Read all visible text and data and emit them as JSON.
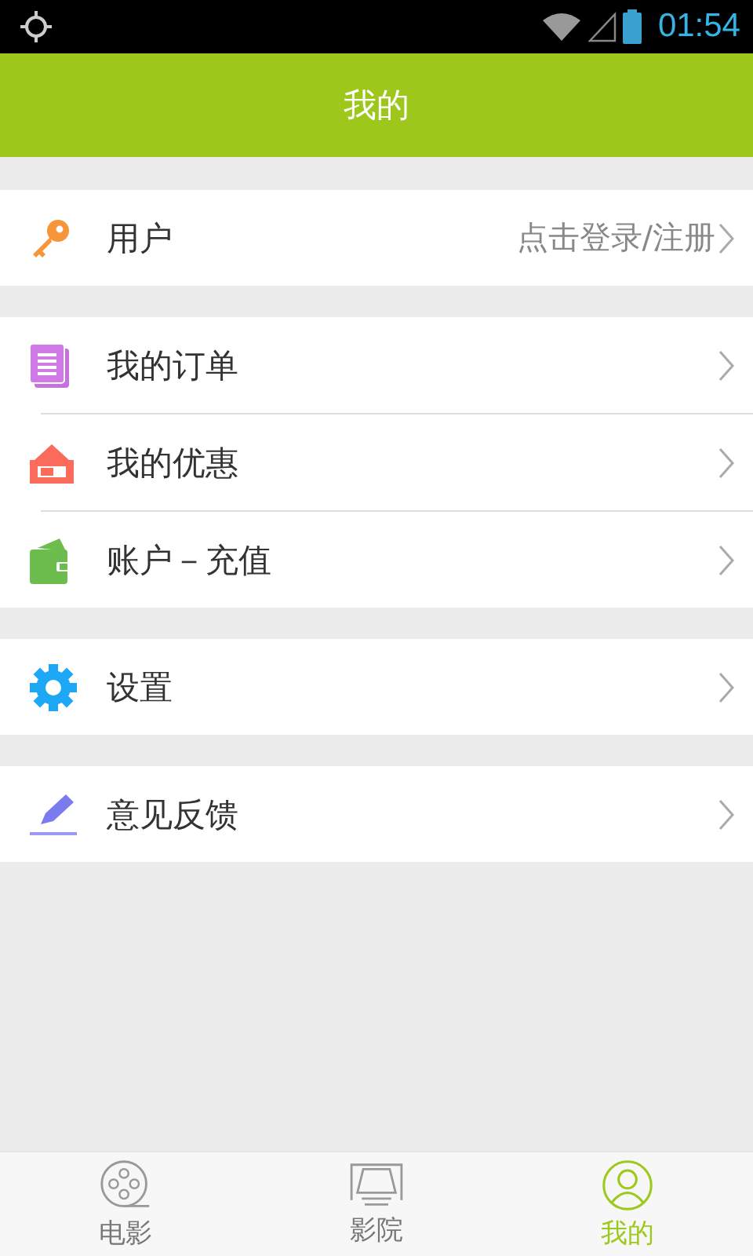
{
  "status_bar": {
    "time": "01:54"
  },
  "header": {
    "title": "我的"
  },
  "sections": [
    {
      "items": [
        {
          "label": "用户",
          "value": "点击登录/注册"
        }
      ]
    },
    {
      "items": [
        {
          "label": "我的订单"
        },
        {
          "label": "我的优惠"
        },
        {
          "label": "账户－充值"
        }
      ]
    },
    {
      "items": [
        {
          "label": "设置"
        }
      ]
    },
    {
      "items": [
        {
          "label": "意见反馈"
        }
      ]
    }
  ],
  "tabs": [
    {
      "label": "电影",
      "selected": false
    },
    {
      "label": "影院",
      "selected": false
    },
    {
      "label": "我的",
      "selected": true
    }
  ]
}
